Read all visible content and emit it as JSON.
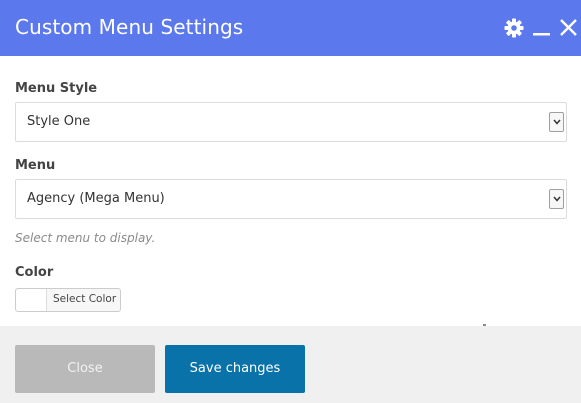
{
  "dialog": {
    "title": "Custom Menu Settings",
    "header_color": "#5b78ec",
    "icons": [
      "gear-icon",
      "minimize-icon",
      "close-icon"
    ]
  },
  "fields": {
    "menu_style": {
      "label": "Menu Style",
      "value": "Style One"
    },
    "menu": {
      "label": "Menu",
      "value": "Agency (Mega Menu)",
      "hint": "Select menu to display."
    },
    "color": {
      "label": "Color",
      "button_label": "Select Color",
      "swatch_color": "#ffffff"
    }
  },
  "footer": {
    "close_label": "Close",
    "save_label": "Save changes",
    "save_color": "#0872a9"
  }
}
